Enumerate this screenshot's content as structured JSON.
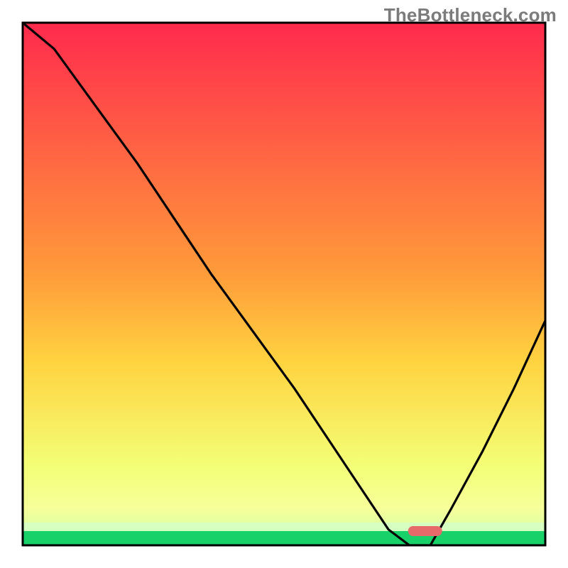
{
  "watermark": "TheBottleneck.com",
  "chart_data": {
    "type": "line",
    "title": "",
    "xlabel": "",
    "ylabel": "",
    "xlim": [
      0,
      100
    ],
    "ylim": [
      0,
      100
    ],
    "grid": false,
    "legend": false,
    "background_gradient_top": "#ff2a4d",
    "background_gradient_mid": "#ffd340",
    "background_gradient_bottom": "#f6ff9a",
    "baseline_green": "#18d169",
    "marker_color": "#e76a6a",
    "marker_x": 77,
    "curve": {
      "x": [
        0,
        6,
        14,
        22,
        36,
        52,
        62,
        70,
        74,
        78,
        82,
        88,
        94,
        100
      ],
      "y": [
        100,
        95,
        84,
        73,
        52,
        30,
        15,
        3,
        0,
        0,
        7,
        18,
        30,
        43
      ]
    },
    "annotations": []
  },
  "colors": {
    "frame": "#000000",
    "curve": "#000000"
  }
}
